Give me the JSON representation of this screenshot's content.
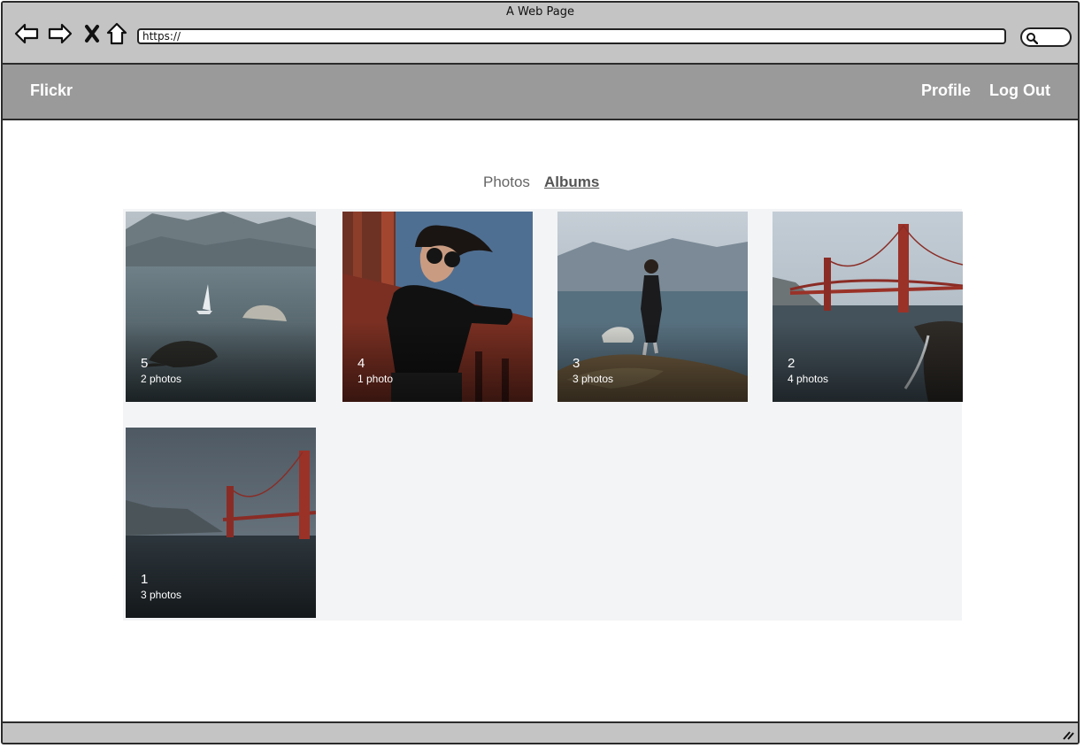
{
  "browser": {
    "title": "A Web Page",
    "url": "https://"
  },
  "header": {
    "brand": "Flickr",
    "links": [
      "Profile",
      "Log Out"
    ]
  },
  "tabs": [
    {
      "label": "Photos",
      "active": false
    },
    {
      "label": "Albums",
      "active": true
    }
  ],
  "albums": [
    {
      "title": "5",
      "count": "2 photos",
      "image": "bay-sailboats"
    },
    {
      "title": "4",
      "count": "1 photo",
      "image": "woman-sunglasses-bridge-rail"
    },
    {
      "title": "3",
      "count": "3 photos",
      "image": "woman-on-rocks-by-bay"
    },
    {
      "title": "2",
      "count": "4 photos",
      "image": "golden-gate-bridge-coast"
    },
    {
      "title": "1",
      "count": "3 photos",
      "image": "golden-gate-bridge-dusk"
    }
  ],
  "colors": {
    "chrome": "#c4c4c4",
    "header": "#9a9a9a",
    "grid_background": "#f3f4f6"
  }
}
